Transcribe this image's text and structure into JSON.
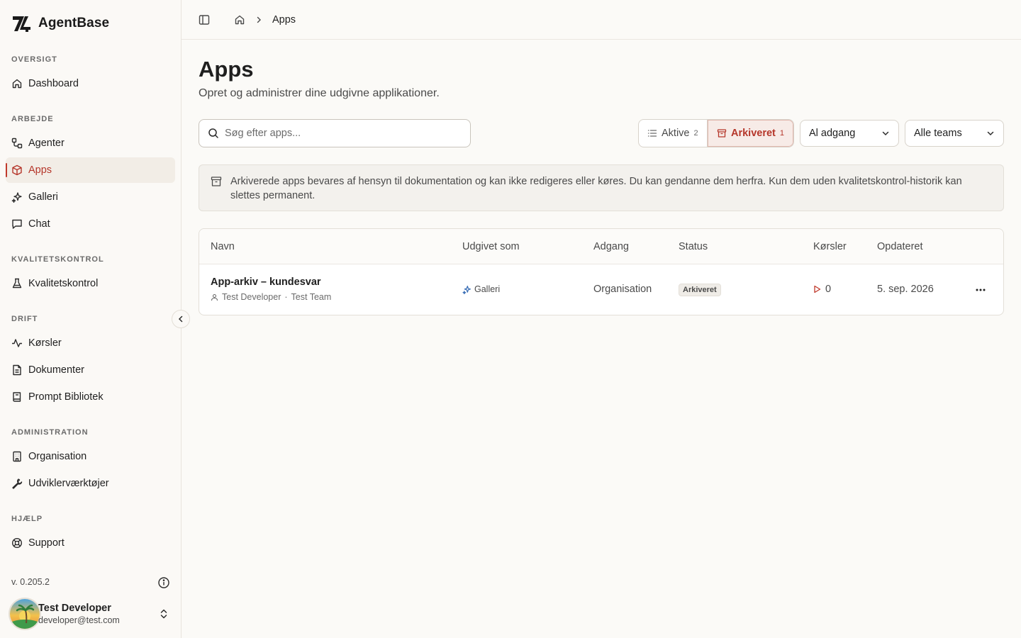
{
  "brand": {
    "name": "AgentBase"
  },
  "sidebar": {
    "sections": [
      {
        "title": "OVERSIGT",
        "items": [
          {
            "label": "Dashboard",
            "icon": "home-icon"
          }
        ]
      },
      {
        "title": "ARBEJDE",
        "items": [
          {
            "label": "Agenter",
            "icon": "workflow-icon"
          },
          {
            "label": "Apps",
            "icon": "box-icon",
            "active": true
          },
          {
            "label": "Galleri",
            "icon": "sparkles-icon"
          },
          {
            "label": "Chat",
            "icon": "chat-icon"
          }
        ]
      },
      {
        "title": "KVALITETSKONTROL",
        "items": [
          {
            "label": "Kvalitetskontrol",
            "icon": "flask-icon"
          }
        ]
      },
      {
        "title": "DRIFT",
        "items": [
          {
            "label": "Kørsler",
            "icon": "activity-icon"
          },
          {
            "label": "Dokumenter",
            "icon": "document-icon"
          },
          {
            "label": "Prompt Bibliotek",
            "icon": "book-icon"
          }
        ]
      },
      {
        "title": "ADMINISTRATION",
        "items": [
          {
            "label": "Organisation",
            "icon": "building-icon"
          },
          {
            "label": "Udviklerværktøjer",
            "icon": "wrench-icon"
          }
        ]
      },
      {
        "title": "HJÆLP",
        "items": [
          {
            "label": "Support",
            "icon": "lifebuoy-icon"
          }
        ]
      }
    ],
    "version": "v. 0.205.2",
    "user": {
      "name": "Test Developer",
      "email": "developer@test.com"
    }
  },
  "header": {
    "breadcrumb_current": "Apps"
  },
  "main": {
    "title": "Apps",
    "subtitle": "Opret og administrer dine udgivne applikationer.",
    "search_placeholder": "Søg efter apps...",
    "filters": {
      "active_label": "Aktive",
      "active_count": "2",
      "archived_label": "Arkiveret",
      "archived_count": "1",
      "access": "Al adgang",
      "teams": "Alle teams"
    },
    "notice": "Arkiverede apps bevares af hensyn til dokumentation og kan ikke redigeres eller køres. Du kan gendanne dem herfra. Kun dem uden kvalitetskontrol-historik kan slettes permanent.",
    "table": {
      "columns": [
        "Navn",
        "Udgivet som",
        "Adgang",
        "Status",
        "Kørsler",
        "Opdateret"
      ],
      "rows": [
        {
          "name": "App-arkiv – kundesvar",
          "owner": "Test Developer",
          "team": "Test Team",
          "published_as": "Galleri",
          "access": "Organisation",
          "status": "Arkiveret",
          "runs": "0",
          "updated": "5. sep. 2026"
        }
      ]
    }
  },
  "colors": {
    "accent": "#c0392b",
    "accent_bg": "#f7ebe7",
    "background": "#fbfaf7"
  }
}
